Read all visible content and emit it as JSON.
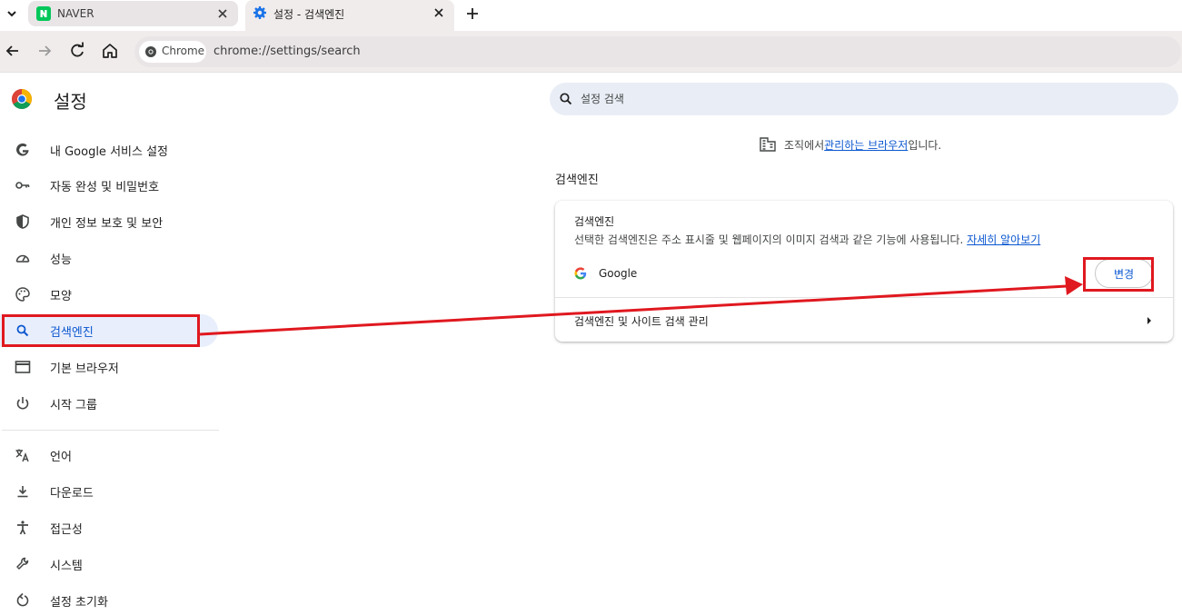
{
  "browser": {
    "tabs": [
      {
        "title": "NAVER",
        "favicon": "naver-icon",
        "active": false
      },
      {
        "title": "설정 - 검색엔진",
        "favicon": "gear-icon",
        "active": true
      }
    ],
    "omnibox": {
      "chip_label": "Chrome",
      "url": "chrome://settings/search"
    }
  },
  "sidebar": {
    "title": "설정",
    "items": [
      {
        "label": "내 Google 서비스 설정",
        "icon": "google-g-icon"
      },
      {
        "label": "자동 완성 및 비밀번호",
        "icon": "key-icon"
      },
      {
        "label": "개인 정보 보호 및 보안",
        "icon": "shield-icon"
      },
      {
        "label": "성능",
        "icon": "speedometer-icon"
      },
      {
        "label": "모양",
        "icon": "palette-icon"
      },
      {
        "label": "검색엔진",
        "icon": "search-icon",
        "active": true
      },
      {
        "label": "기본 브라우저",
        "icon": "browser-window-icon"
      },
      {
        "label": "시작 그룹",
        "icon": "power-icon"
      },
      {
        "label": "언어",
        "icon": "translate-icon"
      },
      {
        "label": "다운로드",
        "icon": "download-icon"
      },
      {
        "label": "접근성",
        "icon": "accessibility-icon"
      },
      {
        "label": "시스템",
        "icon": "wrench-icon"
      },
      {
        "label": "설정 초기화",
        "icon": "reset-icon"
      }
    ]
  },
  "main": {
    "search_placeholder": "설정 검색",
    "managed_notice": {
      "prefix": "조직에서 ",
      "link": "관리하는 브라우저",
      "suffix": "입니다."
    },
    "section_title": "검색엔진",
    "card": {
      "heading": "검색엔진",
      "description": "선택한 검색엔진은 주소 표시줄 및 웹페이지의 이미지 검색과 같은 기능에 사용됩니다. ",
      "learn_more": "자세히 알아보기",
      "engine_name": "Google",
      "change_button": "변경",
      "manage_label": "검색엔진 및 사이트 검색 관리"
    }
  },
  "colors": {
    "accent": "#0b57d0",
    "annotation_red": "#e0181f",
    "active_nav_bg": "#e8eefb",
    "toolbar_bg": "#f1ecec"
  }
}
